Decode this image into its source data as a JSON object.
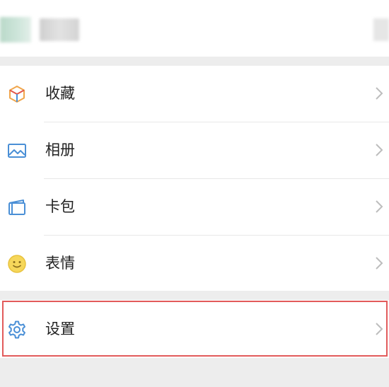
{
  "menu": {
    "items": [
      {
        "label": "收藏",
        "icon": "favorites-cube-icon"
      },
      {
        "label": "相册",
        "icon": "album-picture-icon"
      },
      {
        "label": "卡包",
        "icon": "card-wallet-icon"
      },
      {
        "label": "表情",
        "icon": "emoji-smile-icon"
      }
    ],
    "settings": {
      "label": "设置",
      "icon": "settings-gear-icon"
    }
  },
  "colors": {
    "background": "#ededed",
    "highlight": "#e25b5b"
  }
}
